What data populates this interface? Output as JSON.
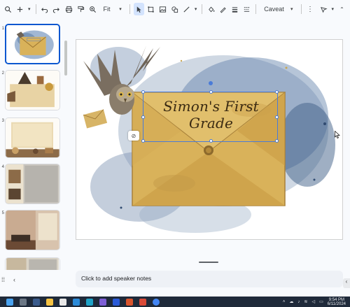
{
  "toolbar": {
    "zoom_label": "Fit",
    "font_label": "Caveat"
  },
  "filmstrip": {
    "slide_numbers": [
      "1",
      "2",
      "3",
      "4",
      "5"
    ],
    "selected_index": 1
  },
  "slide": {
    "title": "Simon's First Grade"
  },
  "notes": {
    "placeholder": "Click to add speaker notes"
  },
  "taskbar": {
    "time": "9:54 PM",
    "date": "6/11/2024"
  },
  "colors": {
    "accent": "#0b57d0",
    "selection": "#4a7bd8",
    "envelope": "#d9b25a",
    "splash": "#5d7fa8"
  }
}
